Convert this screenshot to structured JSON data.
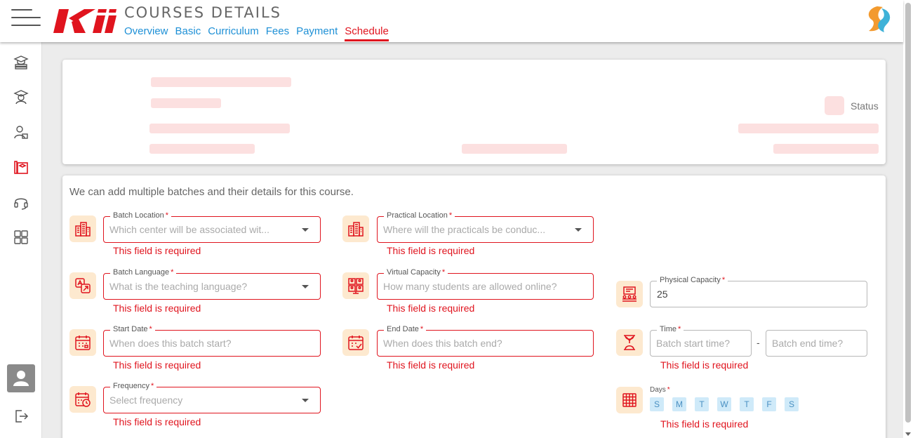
{
  "header": {
    "title": "COURSES DETAILS",
    "tabs": [
      "Overview",
      "Basic",
      "Curriculum",
      "Fees",
      "Payment",
      "Schedule"
    ],
    "active_tab": "Schedule",
    "logo_text": "Kii"
  },
  "sidebar": {
    "items": [
      "courses-icon",
      "graduate-icon",
      "user-info-icon",
      "course-book-icon",
      "headset-icon",
      "dashboard-grid-icon"
    ],
    "active_item": "course-book-icon",
    "bottom": [
      "avatar",
      "logout-icon"
    ]
  },
  "overview_card": {
    "status_label": "Status"
  },
  "schedule_form": {
    "intro": "We can add multiple batches and their details for this course.",
    "error_text": "This field is required",
    "batch_location": {
      "label": "Batch Location",
      "placeholder": "Which center will be associated wit..."
    },
    "practical_location": {
      "label": "Practical Location",
      "placeholder": "Where will the practicals be conduc..."
    },
    "batch_language": {
      "label": "Batch Language",
      "placeholder": "What is the teaching language?"
    },
    "virtual_capacity": {
      "label": "Virtual Capacity",
      "placeholder": "How many students are allowed online?"
    },
    "physical_capacity": {
      "label": "Physical Capacity",
      "value": "25"
    },
    "start_date": {
      "label": "Start Date",
      "placeholder": "When does this batch start?"
    },
    "end_date": {
      "label": "End Date",
      "placeholder": "When does this batch end?"
    },
    "time": {
      "label": "Time",
      "start_placeholder": "Batch start time?",
      "end_placeholder": "Batch end time?",
      "separator": "-"
    },
    "frequency": {
      "label": "Frequency",
      "placeholder": "Select frequency"
    },
    "days": {
      "label": "Days",
      "options": [
        "S",
        "M",
        "T",
        "W",
        "T",
        "F",
        "S"
      ]
    },
    "required_marker": "*"
  },
  "colors": {
    "accent_red": "#e0141e",
    "link_blue": "#1e90d6",
    "icon_bg": "#fde9cf",
    "skeleton": "#fce0e0",
    "day_chip": "#cfeaf9"
  }
}
